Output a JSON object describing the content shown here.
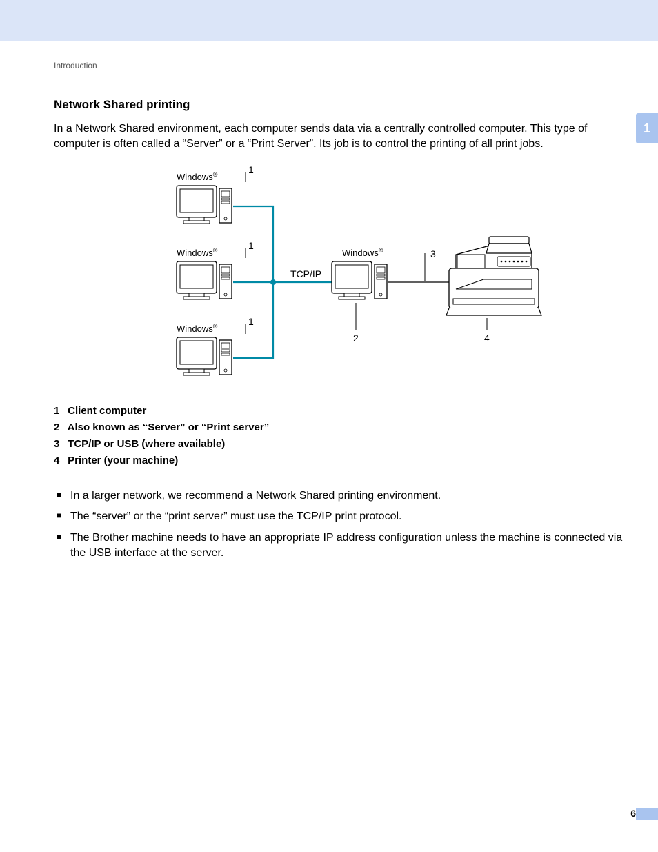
{
  "breadcrumb": "Introduction",
  "section_title": "Network Shared printing",
  "intro_paragraph": "In a Network Shared environment, each computer sends data via a centrally controlled computer. This type of computer is often called a “Server” or a “Print Server”. Its job is to control the printing of all print jobs.",
  "chapter_number": "1",
  "diagram": {
    "client_os_label": "Windows",
    "server_os_label": "Windows",
    "protocol_label": "TCP/IP",
    "callouts": {
      "client": "1",
      "server": "2",
      "connection": "3",
      "printer": "4"
    }
  },
  "legend": [
    {
      "num": "1",
      "text": "Client computer"
    },
    {
      "num": "2",
      "text": "Also known as “Server” or “Print server”"
    },
    {
      "num": "3",
      "text": "TCP/IP or USB (where available)"
    },
    {
      "num": "4",
      "text": "Printer (your machine)"
    }
  ],
  "bullets": [
    "In a larger network, we recommend a Network Shared printing environment.",
    "The “server” or the “print server” must use the TCP/IP print protocol.",
    "The Brother machine needs to have an appropriate IP address configuration unless the machine is connected via the USB interface at the server."
  ],
  "page_number": "6"
}
